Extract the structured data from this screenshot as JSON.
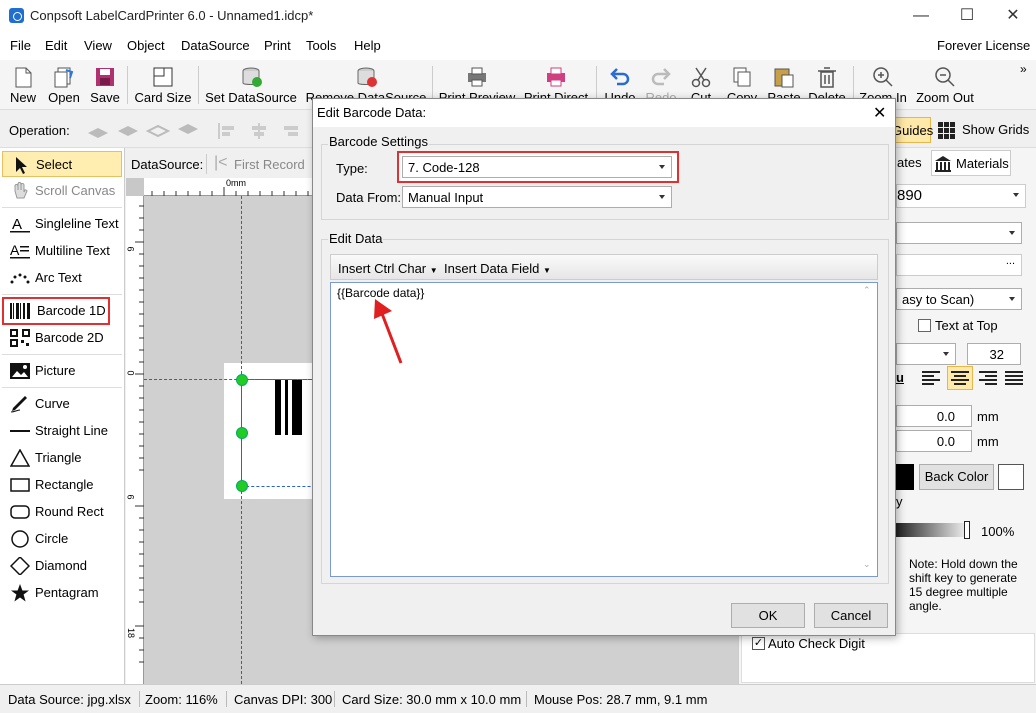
{
  "window": {
    "title": "Conpsoft LabelCardPrinter 6.0 - Unnamed1.idcp*"
  },
  "menu": {
    "items": [
      "File",
      "Edit",
      "View",
      "Object",
      "DataSource",
      "Print",
      "Tools",
      "Help"
    ],
    "license": "Forever License"
  },
  "toolbar": {
    "new": "New",
    "open": "Open",
    "save": "Save",
    "card_size": "Card Size",
    "set_ds": "Set DataSource",
    "remove_ds": "Remove DataSource",
    "print_preview": "Print Preview",
    "print_direct": "Print Direct",
    "undo": "Undo",
    "redo": "Redo",
    "cut": "Cut",
    "copy": "Copy",
    "paste": "Paste",
    "delete": "Delete",
    "zoom_in": "Zoom In",
    "zoom_out": "Zoom Out"
  },
  "opbar": {
    "label": "Operation:",
    "guides": "Guides",
    "show_grids": "Show Grids"
  },
  "datasource": {
    "label": "DataSource:",
    "first_record": "First Record"
  },
  "tools": {
    "select": "Select",
    "scroll": "Scroll Canvas",
    "single": "Singleline Text",
    "multi": "Multiline Text",
    "arc": "Arc Text",
    "bc1d": "Barcode 1D",
    "bc2d": "Barcode 2D",
    "picture": "Picture",
    "curve": "Curve",
    "line": "Straight Line",
    "triangle": "Triangle",
    "rectangle": "Rectangle",
    "roundrect": "Round Rect",
    "circle": "Circle",
    "diamond": "Diamond",
    "pentagram": "Pentagram"
  },
  "ruler": {
    "top_zero": "0mm",
    "left_marks": [
      "6",
      "0",
      "6",
      "18"
    ]
  },
  "right_panel": {
    "tab_templates": "ates",
    "tab_materials": "Materials",
    "combo1": "890",
    "combo3": "asy to Scan)",
    "text_at_top": "Text at Top",
    "font_size": "32",
    "underline_partial": "u",
    "x_val": "0.0",
    "y_val": "0.0",
    "unit": "mm",
    "back_color": "Back Color",
    "letter_y": "y",
    "opacity": "100%",
    "note": "Note: Hold down the shift key to generate 15 degree multiple angle.",
    "auto_check": "Auto Check Digit"
  },
  "dialog": {
    "title": "Edit Barcode Data:",
    "settings_group": "Barcode Settings",
    "type_label": "Type:",
    "type_value": "7.  Code-128",
    "from_label": "Data From:",
    "from_value": "Manual Input",
    "edit_group": "Edit Data",
    "insert_ctrl": "Insert Ctrl Char",
    "insert_field": "Insert Data Field",
    "data_text": "{{Barcode data}}",
    "ok": "OK",
    "cancel": "Cancel"
  },
  "status": {
    "ds": "Data Source: jpg.xlsx",
    "zoom": "Zoom: 116%",
    "dpi": "Canvas DPI: 300",
    "card": "Card Size: 30.0 mm x 10.0 mm",
    "mouse": "Mouse Pos: 28.7 mm, 9.1 mm"
  },
  "colors": {
    "accent_red": "#e03030",
    "selection_blue": "#2b5fd9",
    "handle_green": "#22cc22"
  }
}
